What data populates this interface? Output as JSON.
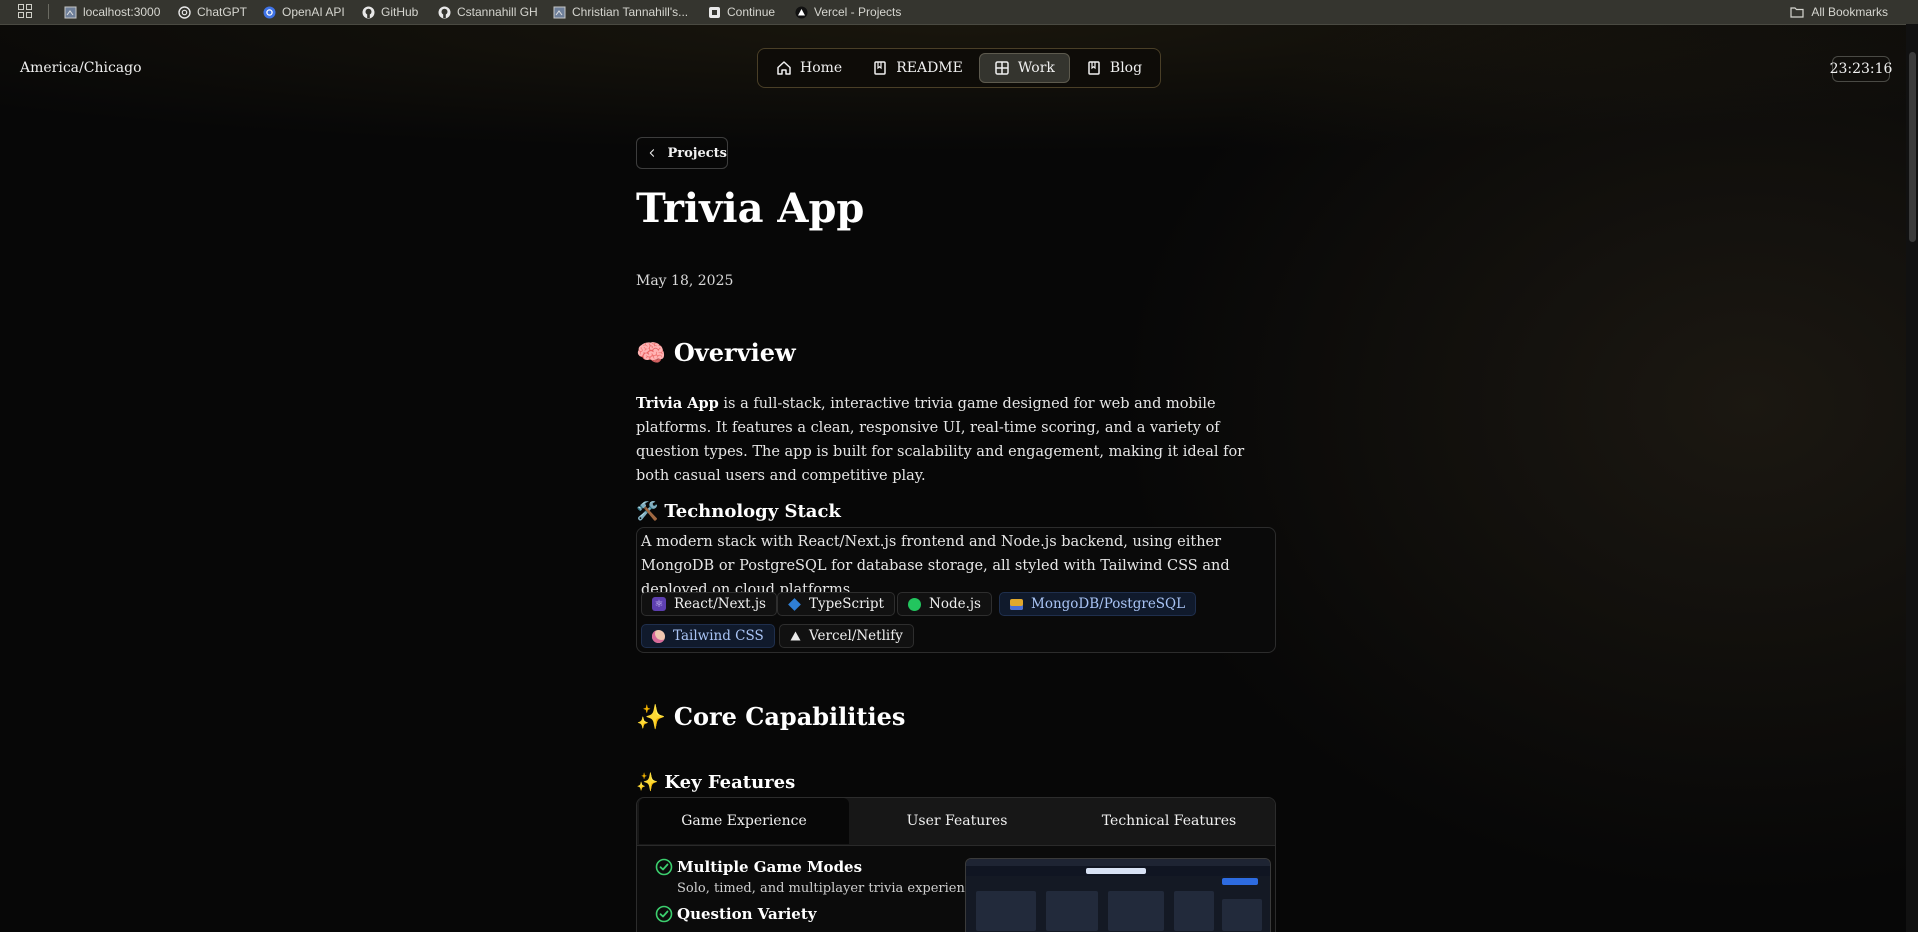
{
  "bookmarks": {
    "items": [
      {
        "label": "localhost:3000",
        "icon": "page-icon"
      },
      {
        "label": "ChatGPT",
        "icon": "openai-icon"
      },
      {
        "label": "OpenAI API",
        "icon": "openai-icon"
      },
      {
        "label": "GitHub",
        "icon": "github-icon"
      },
      {
        "label": "Cstannahill GH",
        "icon": "github-icon"
      },
      {
        "label": "Christian Tannahill's...",
        "icon": "page-icon"
      },
      {
        "label": "Continue",
        "icon": "continue-icon"
      },
      {
        "label": "Vercel - Projects",
        "icon": "vercel-icon"
      }
    ],
    "all_bookmarks": "All Bookmarks"
  },
  "header": {
    "timezone": "America/Chicago",
    "clock": "23:23:16",
    "nav": [
      {
        "label": "Home",
        "icon": "home-icon"
      },
      {
        "label": "README",
        "icon": "book-icon"
      },
      {
        "label": "Work",
        "icon": "grid-icon",
        "active": true
      },
      {
        "label": "Blog",
        "icon": "book-icon"
      }
    ]
  },
  "page": {
    "back_label": "Projects",
    "title": "Trivia App",
    "date": "May 18, 2025",
    "overview": {
      "emoji": "🧠",
      "heading": "Overview",
      "bold_lead": "Trivia App",
      "text": " is a full-stack, interactive trivia game designed for web and mobile platforms. It features a clean, responsive UI, real-time scoring, and a variety of question types. The app is built for scalability and engagement, making it ideal for both casual users and competitive play."
    },
    "tech_stack": {
      "emoji": "🛠️",
      "heading": "Technology Stack",
      "description": "A modern stack with React/Next.js frontend and Node.js backend, using either MongoDB or PostgreSQL for database storage, all styled with Tailwind CSS and deployed on cloud platforms.",
      "chips": [
        {
          "label": "React/Next.js",
          "icon": "atom-icon"
        },
        {
          "label": "TypeScript",
          "icon": "diamond-icon"
        },
        {
          "label": "Node.js",
          "icon": "green-dot-icon"
        },
        {
          "label": "MongoDB/PostgreSQL",
          "icon": "database-icon",
          "highlight": true
        },
        {
          "label": "Tailwind CSS",
          "icon": "palette-icon",
          "highlight": true
        },
        {
          "label": "Vercel/Netlify",
          "icon": "triangle-icon"
        }
      ]
    },
    "core": {
      "emoji": "✨",
      "heading": "Core Capabilities"
    },
    "key_features": {
      "emoji": "✨",
      "heading": "Key Features",
      "tabs": [
        "Game Experience",
        "User Features",
        "Technical Features"
      ],
      "active_tab": 0,
      "features": [
        {
          "title": "Multiple Game Modes",
          "desc": "Solo, timed, and multiplayer trivia experiences"
        },
        {
          "title": "Question Variety",
          "desc": ""
        }
      ]
    }
  },
  "colors": {
    "background": "#070707",
    "nav_border": "#4a3f27",
    "accent_check": "#3ccf6e",
    "chip_highlight_text": "#a9c4f5"
  }
}
